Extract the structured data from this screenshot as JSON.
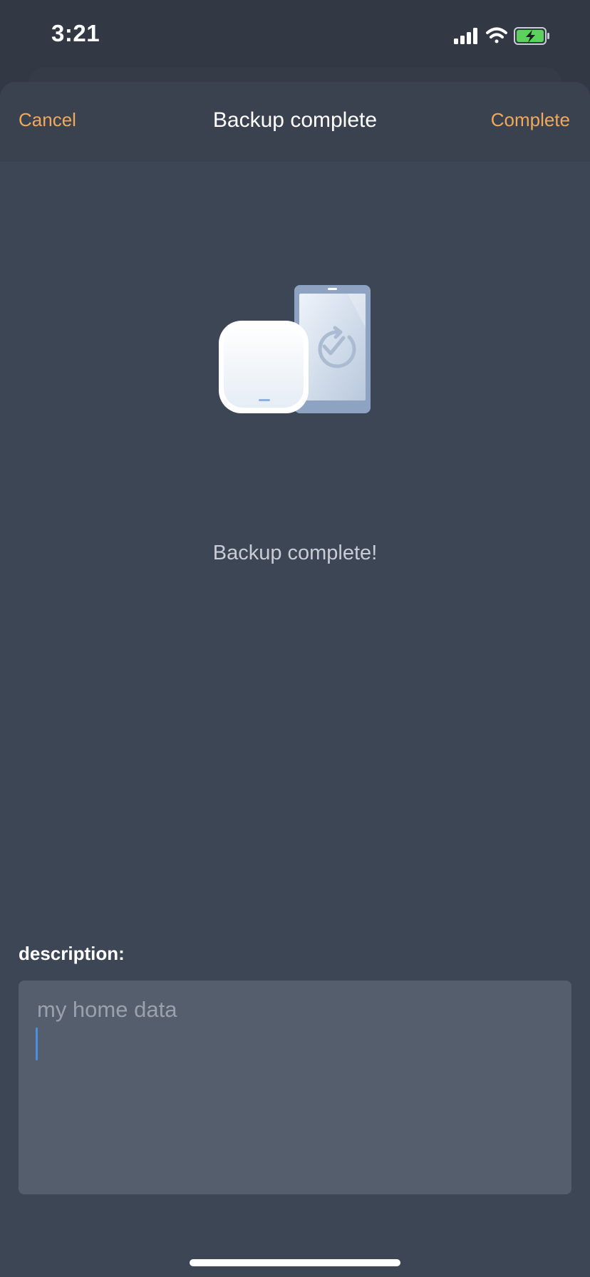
{
  "status_bar": {
    "time": "3:21",
    "icons": [
      "signal-icon",
      "wifi-icon",
      "battery-charging-icon"
    ],
    "battery_color": "#5bd25b"
  },
  "nav": {
    "cancel_label": "Cancel",
    "title": "Backup complete",
    "complete_label": "Complete",
    "accent_color": "#f0a85a"
  },
  "illustration": {
    "icons": [
      "hub-device-icon",
      "phone-icon",
      "backup-check-icon"
    ]
  },
  "main": {
    "message": "Backup complete!"
  },
  "description": {
    "label": "description:",
    "placeholder": "my home data"
  }
}
